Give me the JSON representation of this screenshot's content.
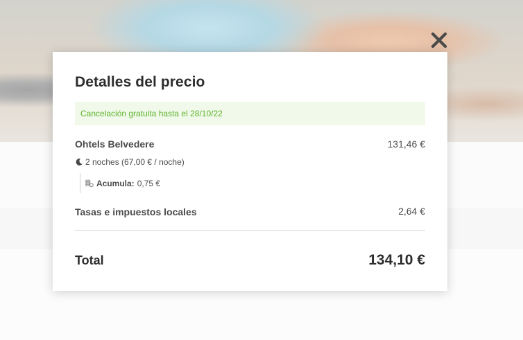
{
  "modal": {
    "title": "Detalles del precio",
    "cancellation_notice": "Cancelación gratuita hasta el 28/10/22",
    "hotel": {
      "name": "Ohtels Belvedere",
      "price": "131,46 €",
      "nights": "2 noches (67,00 € / noche)",
      "accumulate_label": "Acumula:",
      "accumulate_value": "0,75 €"
    },
    "taxes": {
      "label": "Tasas e impuestos locales",
      "price": "2,64 €"
    },
    "total": {
      "label": "Total",
      "price": "134,10 €"
    }
  },
  "icons": {
    "close": "close-icon",
    "moon": "moon-icon",
    "coins": "coins-icon"
  },
  "colors": {
    "notice_text": "#5fb32d",
    "notice_bg": "#f0f9ea",
    "text_dark": "#2d2d2d",
    "text_body": "#4a4a4a"
  }
}
